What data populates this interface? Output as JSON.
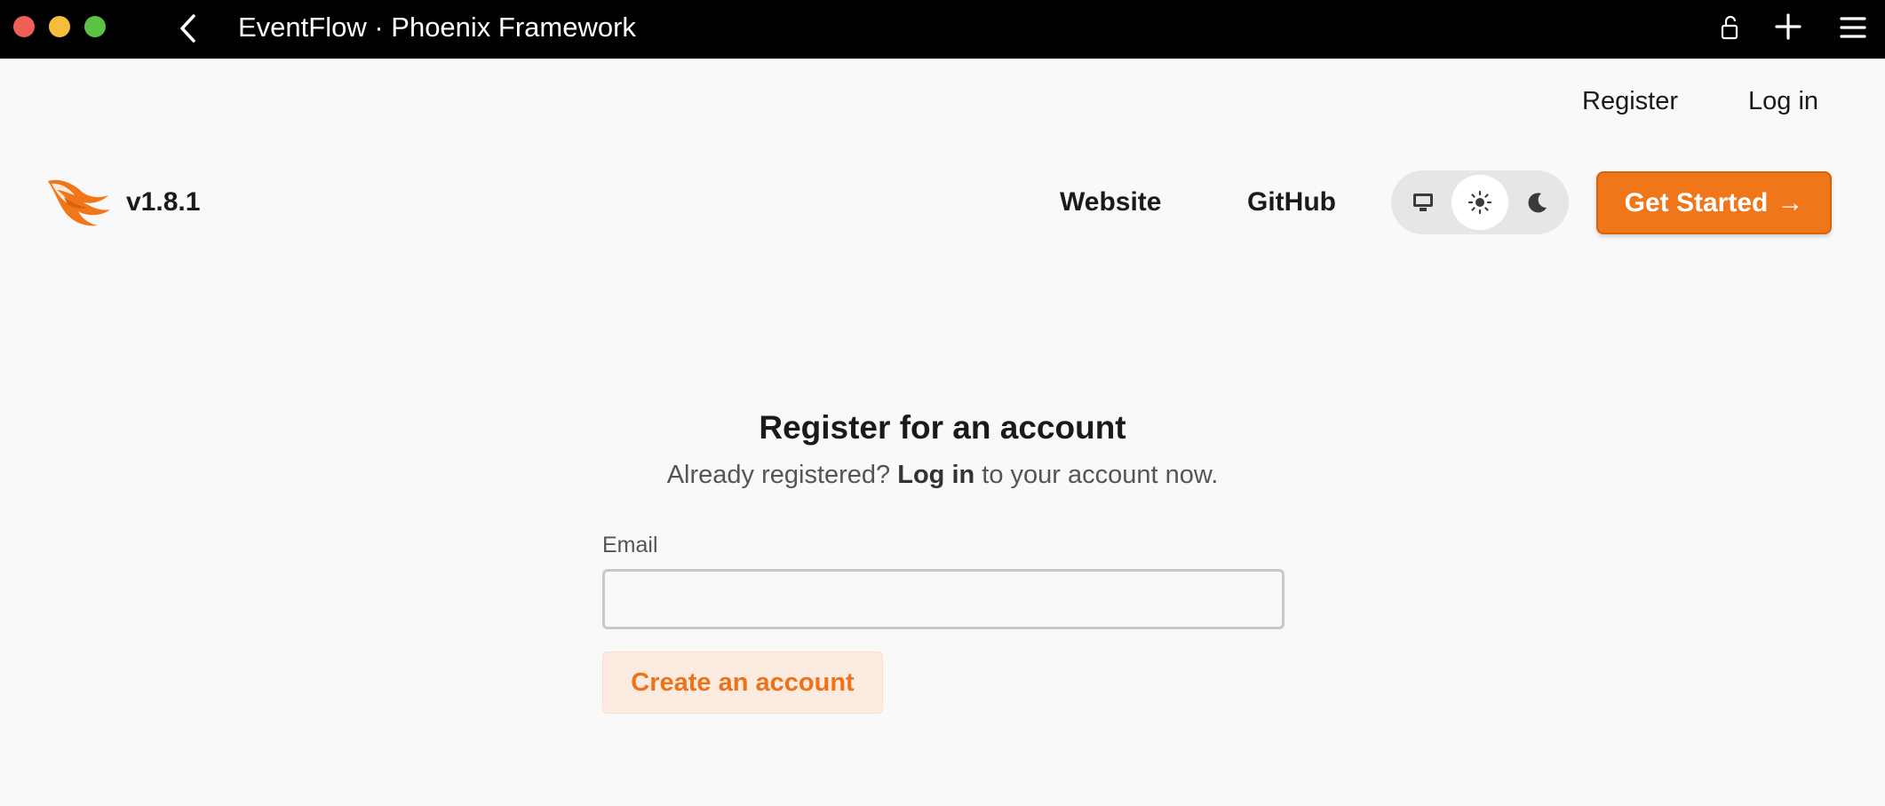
{
  "window": {
    "title": "EventFlow · Phoenix Framework",
    "controls": [
      "close",
      "minimize",
      "zoom"
    ]
  },
  "auth_links": {
    "register": "Register",
    "login": "Log in"
  },
  "header": {
    "version": "v1.8.1",
    "nav": {
      "website": "Website",
      "github": "GitHub"
    },
    "theme": {
      "options": [
        "system",
        "light",
        "dark"
      ],
      "selected": "light"
    },
    "cta": {
      "label": "Get Started",
      "arrow": "→"
    }
  },
  "form": {
    "title": "Register for an account",
    "subtitle_prefix": "Already registered?",
    "subtitle_link": "Log in",
    "subtitle_suffix": "to your account now.",
    "email_label": "Email",
    "email_value": "",
    "submit_label": "Create an account"
  },
  "colors": {
    "accent": "#f0761a",
    "accent_soft": "#fcebe1",
    "background": "#f9f9f9",
    "titlebar": "#000000"
  }
}
